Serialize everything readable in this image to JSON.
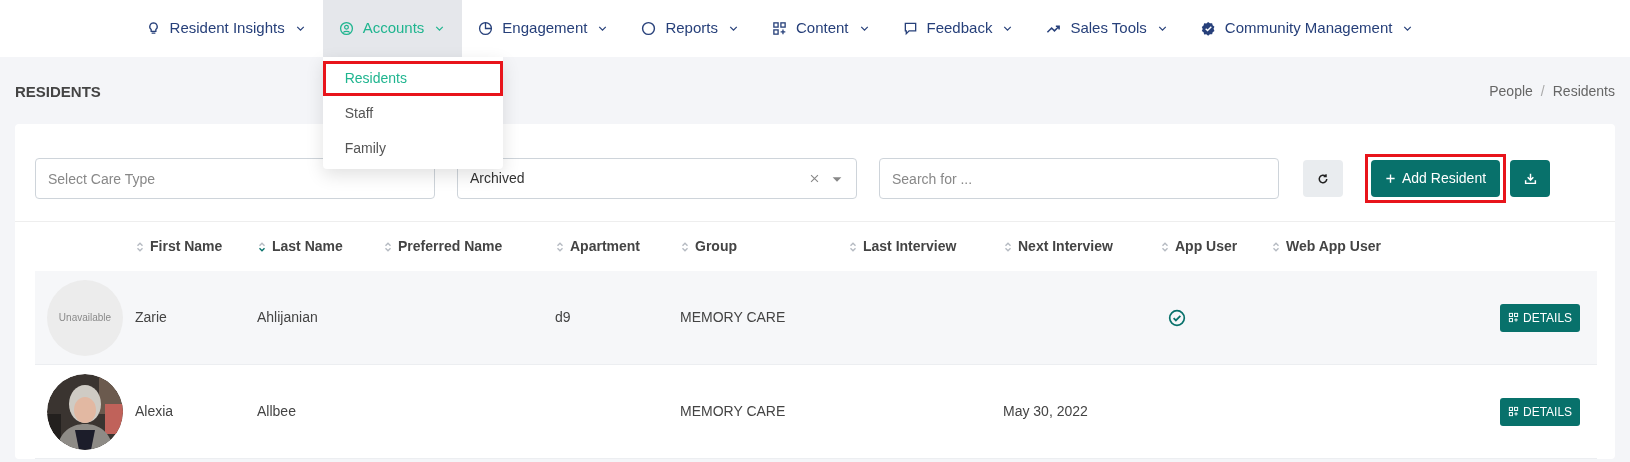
{
  "nav": [
    {
      "label": "Resident Insights",
      "selected": false
    },
    {
      "label": "Accounts",
      "selected": true
    },
    {
      "label": "Engagement",
      "selected": false
    },
    {
      "label": "Reports",
      "selected": false
    },
    {
      "label": "Content",
      "selected": false
    },
    {
      "label": "Feedback",
      "selected": false
    },
    {
      "label": "Sales Tools",
      "selected": false
    },
    {
      "label": "Community Management",
      "selected": false
    }
  ],
  "menu": [
    {
      "label": "Residents",
      "selected": true,
      "highlighted": true
    },
    {
      "label": "Staff",
      "selected": false,
      "highlighted": false
    },
    {
      "label": "Family",
      "selected": false,
      "highlighted": false
    }
  ],
  "page_title": "RESIDENTS",
  "breadcrumb": {
    "items": [
      "People",
      "Residents"
    ],
    "separator": "/"
  },
  "filters": {
    "care_type": {
      "placeholder": "Select Care Type"
    },
    "status": {
      "value": "Archived"
    },
    "search": {
      "placeholder": "Search for ..."
    }
  },
  "add_button": {
    "label": "Add Resident",
    "highlighted": true
  },
  "table": {
    "columns": [
      {
        "label": "First Name",
        "sorted": false
      },
      {
        "label": "Last Name",
        "sorted": true
      },
      {
        "label": "Preferred Name",
        "sorted": false
      },
      {
        "label": "Apartment",
        "sorted": false
      },
      {
        "label": "Group",
        "sorted": false
      },
      {
        "label": "Last Interview",
        "sorted": false
      },
      {
        "label": "Next Interview",
        "sorted": false
      },
      {
        "label": "App User",
        "sorted": false
      },
      {
        "label": "Web App User",
        "sorted": false
      }
    ],
    "rows": [
      {
        "avatar": {
          "kind": "placeholder",
          "text": "Unavailable"
        },
        "first_name": "Zarie",
        "last_name": "Ahlijanian",
        "apartment": "d9",
        "group": "MEMORY CARE",
        "app_user": true,
        "button": "DETAILS"
      },
      {
        "first_name": "Alexia",
        "last_name": "Allbee",
        "group": "MEMORY CARE",
        "next_interview": "May 30, 2022",
        "app_user": false,
        "button": "DETAILS"
      }
    ]
  }
}
